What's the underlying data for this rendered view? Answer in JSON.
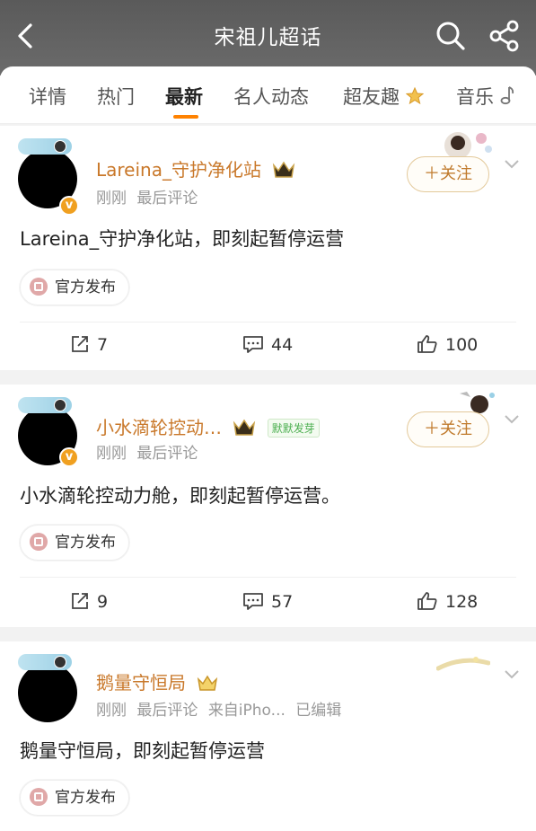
{
  "header": {
    "title": "宋祖儿超话"
  },
  "tabs": [
    {
      "label": "详情"
    },
    {
      "label": "热门"
    },
    {
      "label": "最新"
    },
    {
      "label": "名人动态"
    },
    {
      "label": "超友趣"
    },
    {
      "label": "音乐"
    }
  ],
  "follow_label": "＋关注",
  "official_label": "官方发布",
  "posts": [
    {
      "username": "Lareina_守护净化站",
      "meta": [
        "刚刚",
        "最后评论"
      ],
      "content": "Lareina_守护净化站，即刻起暂停运营",
      "reposts": "7",
      "comments": "44",
      "likes": "100"
    },
    {
      "username": "小水滴轮控动…",
      "badge": "默默发芽",
      "meta": [
        "刚刚",
        "最后评论"
      ],
      "content": "小水滴轮控动力舱，即刻起暂停运营。",
      "reposts": "9",
      "comments": "57",
      "likes": "128"
    },
    {
      "username": "鹅量守恒局",
      "meta": [
        "刚刚",
        "最后评论",
        "来自iPho...",
        "已编辑"
      ],
      "content": "鹅量守恒局，即刻起暂停运营"
    }
  ],
  "colors": {
    "accent": "#ff8200",
    "username": "#c9782a",
    "follow_border": "#e3c99a"
  }
}
